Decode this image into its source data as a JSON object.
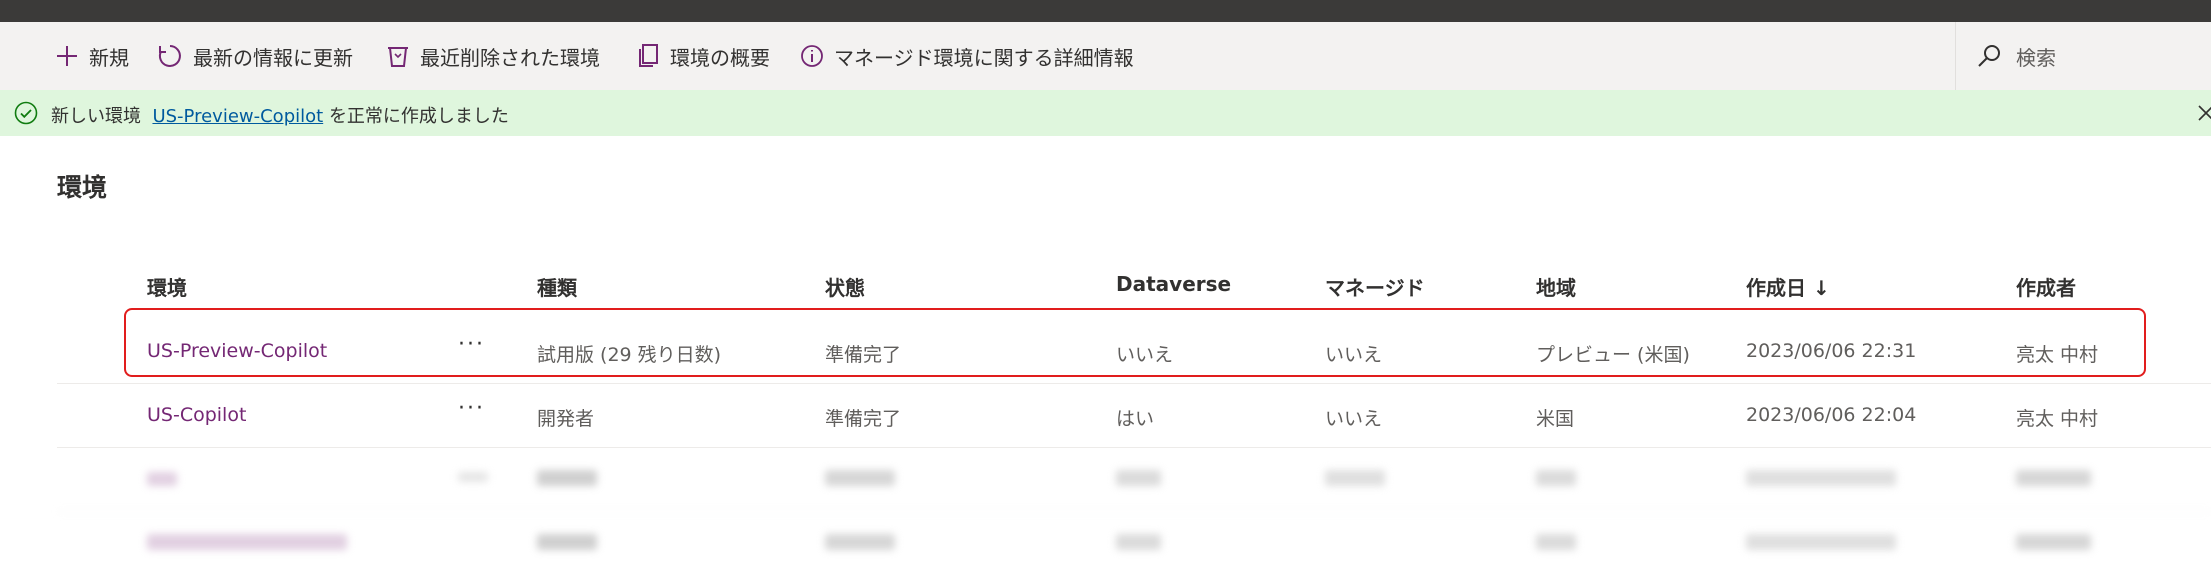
{
  "commandbar": {
    "new_label": "新規",
    "refresh_label": "最新の情報に更新",
    "deleted_label": "最近削除された環境",
    "overview_label": "環境の概要",
    "managed_info_label": "マネージド環境に関する詳細情報",
    "search_placeholder": "検索"
  },
  "banner": {
    "prefix": "新しい環境",
    "link": "US-Preview-Copilot",
    "suffix": "を正常に作成しました"
  },
  "page": {
    "title": "環境"
  },
  "table": {
    "headers": {
      "env": "環境",
      "type": "種類",
      "state": "状態",
      "dataverse": "Dataverse",
      "managed": "マネージド",
      "region": "地域",
      "created": "作成日 ↓",
      "creator": "作成者"
    },
    "more": "···",
    "rows": [
      {
        "env": "US-Preview-Copilot",
        "type": "試用版 (29 残り日数)",
        "state": "準備完了",
        "dataverse": "いいえ",
        "managed": "いいえ",
        "region": "プレビュー (米国)",
        "created": "2023/06/06 22:31",
        "creator": "亮太 中村"
      },
      {
        "env": "US-Copilot",
        "type": "開発者",
        "state": "準備完了",
        "dataverse": "はい",
        "managed": "いいえ",
        "region": "米国",
        "created": "2023/06/06 22:04",
        "creator": "亮太 中村"
      }
    ]
  },
  "colors": {
    "accent": "#742774",
    "banner_bg": "#dff6dd",
    "highlight": "#e11d1d"
  }
}
